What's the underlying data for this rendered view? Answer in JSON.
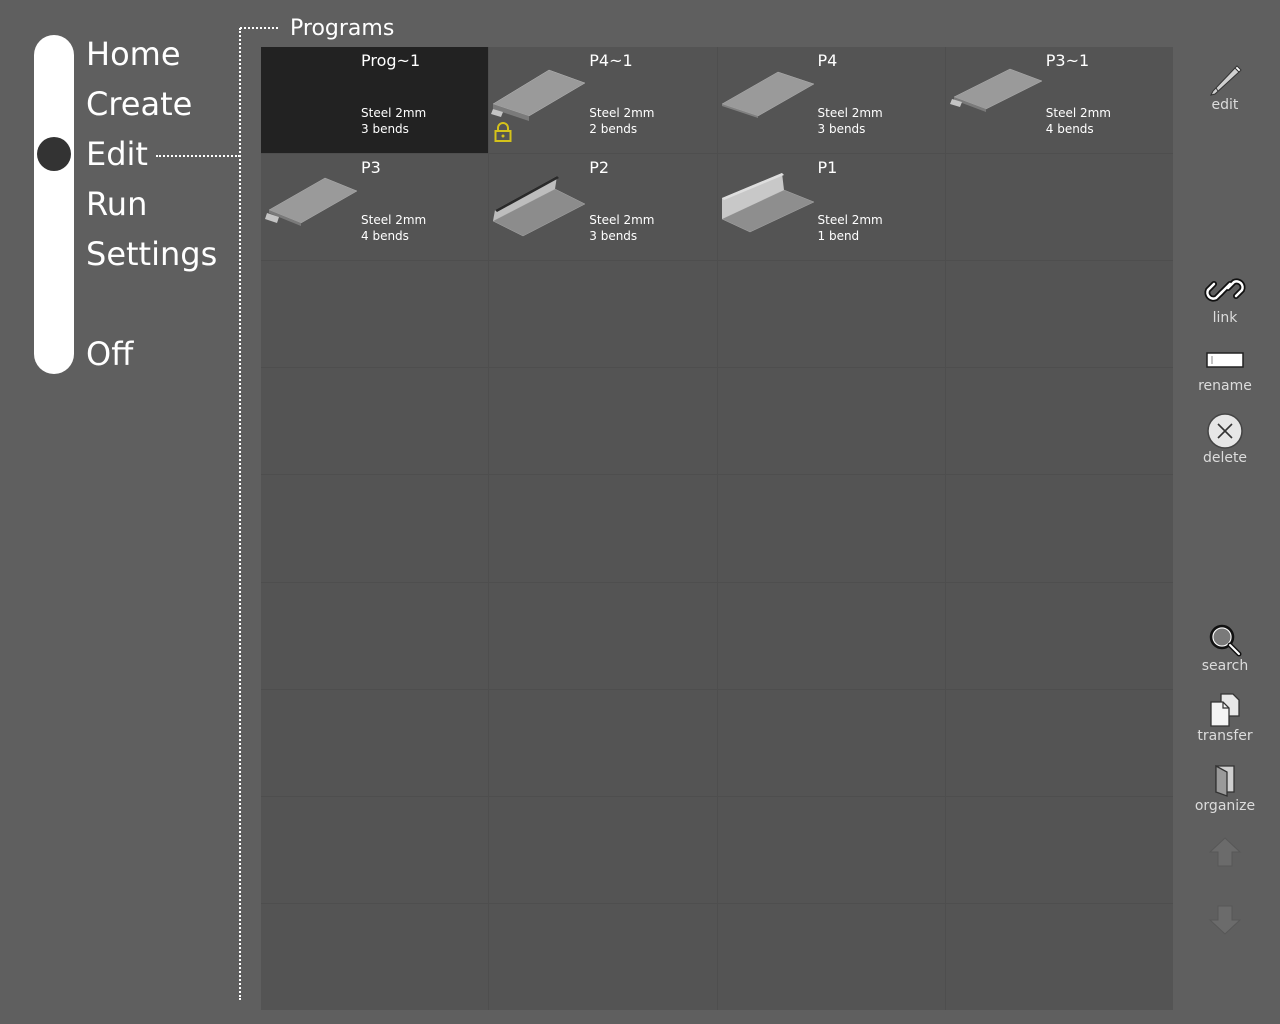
{
  "nav": {
    "items": [
      {
        "label": "Home"
      },
      {
        "label": "Create"
      },
      {
        "label": "Edit"
      },
      {
        "label": "Run"
      },
      {
        "label": "Settings"
      },
      {
        "label": "Off"
      }
    ],
    "active": "Edit"
  },
  "programs": {
    "title": "Programs",
    "items": [
      {
        "name": "Prog~1",
        "material": "Steel 2mm",
        "bends": "3 bends",
        "selected": true,
        "locked": false
      },
      {
        "name": "P4~1",
        "material": "Steel 2mm",
        "bends": "2 bends",
        "selected": false,
        "locked": true
      },
      {
        "name": "P4",
        "material": "Steel 2mm",
        "bends": "3 bends",
        "selected": false,
        "locked": false
      },
      {
        "name": "P3~1",
        "material": "Steel 2mm",
        "bends": "4 bends",
        "selected": false,
        "locked": false
      },
      {
        "name": "P3",
        "material": "Steel 2mm",
        "bends": "4 bends",
        "selected": false,
        "locked": false
      },
      {
        "name": "P2",
        "material": "Steel 2mm",
        "bends": "3 bends",
        "selected": false,
        "locked": false
      },
      {
        "name": "P1",
        "material": "Steel 2mm",
        "bends": "1 bend",
        "selected": false,
        "locked": false
      }
    ]
  },
  "toolbar": {
    "edit": "edit",
    "link": "link",
    "rename": "rename",
    "delete": "delete",
    "search": "search",
    "transfer": "transfer",
    "organize": "organize",
    "up_icon": "arrow-up-icon",
    "down_icon": "arrow-down-icon"
  },
  "colors": {
    "background": "#5f5f5f",
    "grid_cell": "#545454",
    "selected_cell": "#222222",
    "lock_icon": "#d4c21a"
  }
}
